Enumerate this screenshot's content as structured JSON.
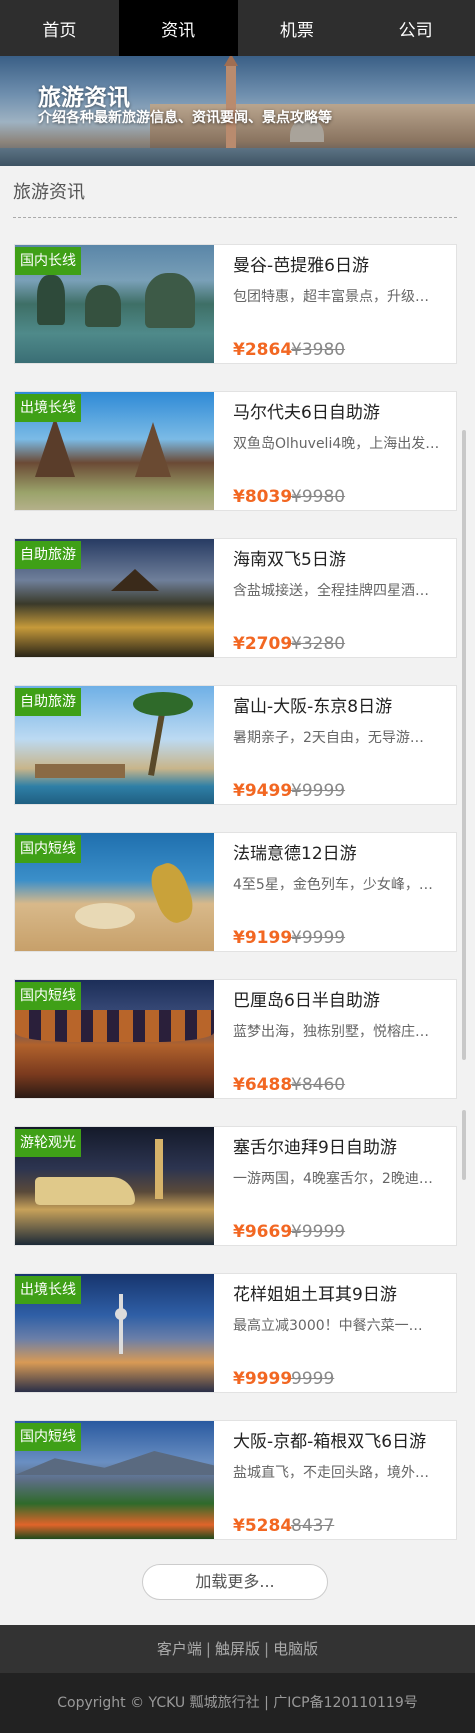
{
  "nav": [
    "首页",
    "资讯",
    "机票",
    "公司"
  ],
  "banner": {
    "title": "旅游资讯",
    "subtitle": "介绍各种最新旅游信息、资讯要闻、景点攻略等"
  },
  "section_title": "旅游资讯",
  "items": [
    {
      "badge": "国内长线",
      "name": "曼谷-芭提雅6日游",
      "desc": "包团特惠，超丰富景点，升级…",
      "price": "¥2864",
      "original_price": "¥3980"
    },
    {
      "badge": "出境长线",
      "name": "马尔代夫6日自助游",
      "desc": "双鱼岛Olhuveli4晚，上海出发…",
      "price": "¥8039",
      "original_price": "¥9980"
    },
    {
      "badge": "自助旅游",
      "name": "海南双飞5日游",
      "desc": "含盐城接送，全程挂牌四星酒…",
      "price": "¥2709",
      "original_price": "¥3280"
    },
    {
      "badge": "自助旅游",
      "name": "富山-大阪-东京8日游",
      "desc": "暑期亲子，2天自由，无导游…",
      "price": "¥9499",
      "original_price": "¥9999"
    },
    {
      "badge": "国内短线",
      "name": "法瑞意德12日游",
      "desc": "4至5星，金色列车，少女峰，…",
      "price": "¥9199",
      "original_price": "¥9999"
    },
    {
      "badge": "国内短线",
      "name": "巴厘岛6日半自助游",
      "desc": "蓝梦出海，独栋别墅，悦榕庄…",
      "price": "¥6488",
      "original_price": "¥8460"
    },
    {
      "badge": "游轮观光",
      "name": "塞舌尔迪拜9日自助游",
      "desc": "一游两国，4晚塞舌尔，2晚迪…",
      "price": "¥9669",
      "original_price": "¥9999"
    },
    {
      "badge": "出境长线",
      "name": "花样姐姐土耳其9日游",
      "desc": "最高立减3000！中餐六菜一…",
      "price": "¥9999",
      "original_price": "9999"
    },
    {
      "badge": "国内短线",
      "name": "大阪-京都-箱根双飞6日游",
      "desc": "盐城直飞，不走回头路，境外…",
      "price": "¥5284",
      "original_price": "8437"
    }
  ],
  "load_more": "加载更多...",
  "footer": {
    "links": [
      "客户端",
      "触屏版",
      "电脑版"
    ],
    "separator": "|",
    "copyright": "Copyright © YCKU 瓢城旅行社 | 广ICP备120110119号"
  }
}
